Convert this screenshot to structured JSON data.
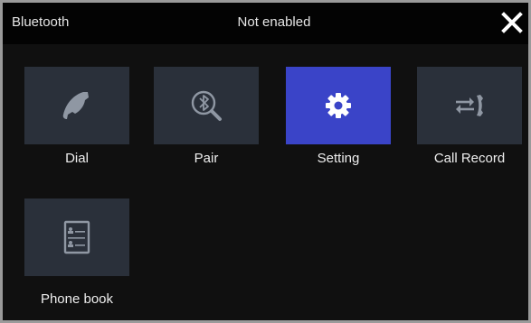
{
  "header": {
    "title": "Bluetooth",
    "status": "Not enabled",
    "close_icon": "close-icon"
  },
  "tiles": [
    {
      "label": "Dial",
      "icon": "phone-icon",
      "active": false
    },
    {
      "label": "Pair",
      "icon": "bluetooth-search-icon",
      "active": false
    },
    {
      "label": "Setting",
      "icon": "gear-icon",
      "active": true
    },
    {
      "label": "Call Record",
      "icon": "call-record-icon",
      "active": false
    },
    {
      "label": "Phone book",
      "icon": "phone-book-icon",
      "active": false
    }
  ],
  "colors": {
    "background": "#101010",
    "tile": "#2a303a",
    "tile_active": "#3a44c8",
    "icon": "#8f97a3",
    "text": "#eeeeee"
  }
}
